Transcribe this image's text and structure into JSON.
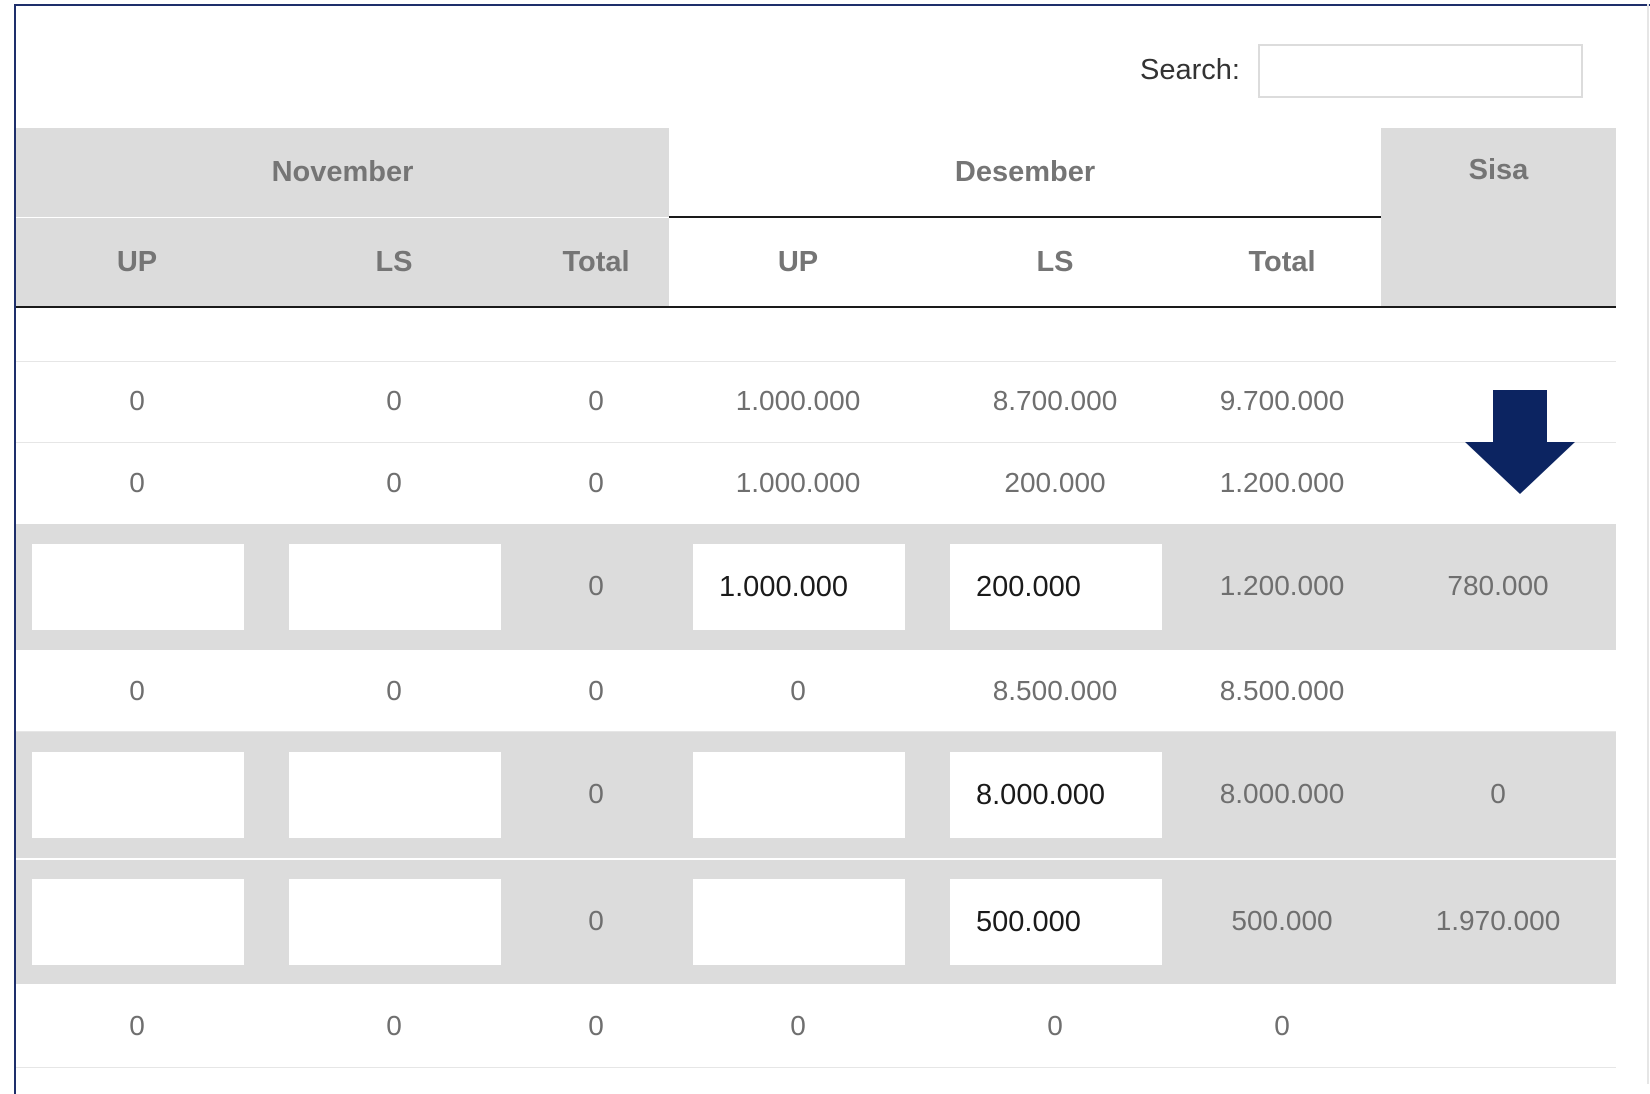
{
  "search": {
    "label": "Search:",
    "value": ""
  },
  "header": {
    "groups": [
      "November",
      "Desember",
      "Sisa"
    ],
    "sub_columns": [
      "UP",
      "LS",
      "Total",
      "UP",
      "LS",
      "Total"
    ]
  },
  "rows": [
    {
      "style": "plain",
      "cells": [
        "0",
        "0",
        "0",
        "1.000.000",
        "8.700.000",
        "9.700.000",
        ""
      ]
    },
    {
      "style": "plain",
      "cells": [
        "0",
        "0",
        "0",
        "1.000.000",
        "200.000",
        "1.200.000",
        ""
      ]
    },
    {
      "style": "edit",
      "cells": [
        "",
        "",
        "0",
        "1.000.000",
        "200.000",
        "1.200.000",
        "780.000"
      ]
    },
    {
      "style": "plain",
      "cells": [
        "0",
        "0",
        "0",
        "0",
        "8.500.000",
        "8.500.000",
        ""
      ]
    },
    {
      "style": "edit",
      "cells": [
        "",
        "",
        "0",
        "",
        "8.000.000",
        "8.000.000",
        "0"
      ]
    },
    {
      "style": "edit",
      "cells": [
        "",
        "",
        "0",
        "",
        "500.000",
        "500.000",
        "1.970.000"
      ]
    },
    {
      "style": "plain",
      "cells": [
        "0",
        "0",
        "0",
        "0",
        "0",
        "0",
        ""
      ]
    }
  ],
  "annotation": {
    "icon": "arrow-down-icon",
    "color": "#0c2461"
  }
}
